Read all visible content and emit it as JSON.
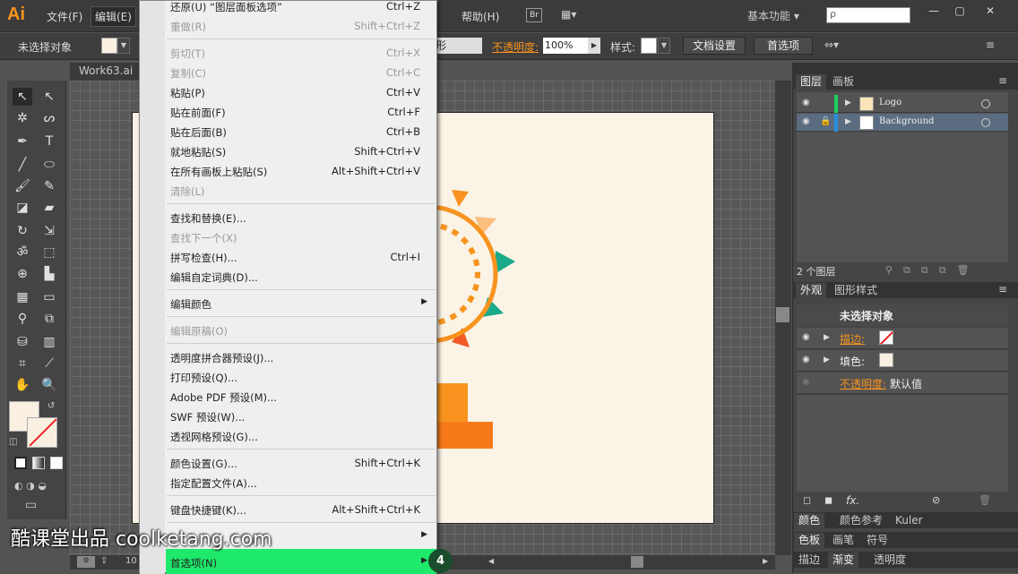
{
  "app": {
    "logo": "Ai",
    "document_tab": "Work63.ai"
  },
  "menubar": {
    "file": "文件(F)",
    "edit": "编辑(E)",
    "help": "帮助(H)",
    "bridge": "Br",
    "arrange": "▦▾",
    "workspace": "基本功能 ▾",
    "search_placeholder": "ρ"
  },
  "window_controls": {
    "minimize": "—",
    "maximize": "▢",
    "close": "✕"
  },
  "control_bar": {
    "selection": "未选择对象",
    "shape": "形",
    "opacity_label": "不透明度:",
    "opacity_value": "100%",
    "style_label": "样式:",
    "doc_settings": "文档设置",
    "preferences": "首选项"
  },
  "edit_menu": {
    "items": [
      {
        "label": "还原(U) “图层面板选项”",
        "shortcut": "Ctrl+Z",
        "disabled": false
      },
      {
        "label": "重做(R)",
        "shortcut": "Shift+Ctrl+Z",
        "disabled": true
      },
      {
        "label": "剪切(T)",
        "shortcut": "Ctrl+X",
        "disabled": true
      },
      {
        "label": "复制(C)",
        "shortcut": "Ctrl+C",
        "disabled": true
      },
      {
        "label": "粘贴(P)",
        "shortcut": "Ctrl+V",
        "disabled": false
      },
      {
        "label": "贴在前面(F)",
        "shortcut": "Ctrl+F",
        "disabled": false
      },
      {
        "label": "贴在后面(B)",
        "shortcut": "Ctrl+B",
        "disabled": false
      },
      {
        "label": "就地粘贴(S)",
        "shortcut": "Shift+Ctrl+V",
        "disabled": false
      },
      {
        "label": "在所有画板上粘贴(S)",
        "shortcut": "Alt+Shift+Ctrl+V",
        "disabled": false
      },
      {
        "label": "清除(L)",
        "shortcut": "",
        "disabled": true
      },
      {
        "label": "查找和替换(E)...",
        "shortcut": "",
        "disabled": false
      },
      {
        "label": "查找下一个(X)",
        "shortcut": "",
        "disabled": true
      },
      {
        "label": "拼写检查(H)...",
        "shortcut": "Ctrl+I",
        "disabled": false
      },
      {
        "label": "编辑自定词典(D)...",
        "shortcut": "",
        "disabled": false
      },
      {
        "label": "编辑颜色",
        "shortcut": "",
        "disabled": false
      },
      {
        "label": "编辑原稿(O)",
        "shortcut": "",
        "disabled": true
      },
      {
        "label": "透明度拼合器预设(J)...",
        "shortcut": "",
        "disabled": false
      },
      {
        "label": "打印预设(Q)...",
        "shortcut": "",
        "disabled": false
      },
      {
        "label": "Adobe PDF 预设(M)...",
        "shortcut": "",
        "disabled": false
      },
      {
        "label": "SWF 预设(W)...",
        "shortcut": "",
        "disabled": false
      },
      {
        "label": "透视网格预设(G)...",
        "shortcut": "",
        "disabled": false
      },
      {
        "label": "颜色设置(G)...",
        "shortcut": "Shift+Ctrl+K",
        "disabled": false
      },
      {
        "label": "指定配置文件(A)...",
        "shortcut": "",
        "disabled": false
      },
      {
        "label": "键盘快捷键(K)...",
        "shortcut": "Alt+Shift+Ctrl+K",
        "disabled": false
      },
      {
        "label": "",
        "shortcut": "",
        "disabled": false
      },
      {
        "label": "首选项(N)",
        "shortcut": "",
        "disabled": false
      }
    ],
    "step_badge": "4"
  },
  "layers_panel": {
    "tabs": [
      "图层",
      "画板"
    ],
    "layers": [
      {
        "name": "Logo"
      },
      {
        "name": "Background"
      }
    ],
    "count": "2 个图层"
  },
  "appearance_panel": {
    "tabs": [
      "外观",
      "图形样式"
    ],
    "title": "未选择对象",
    "stroke_label": "描边:",
    "fill_label": "填色:",
    "opacity_label": "不透明度:",
    "opacity_value": "默认值",
    "footer_fx": "fx."
  },
  "bottom_panels": {
    "row1": [
      "颜色",
      "颜色参考",
      "Kuler"
    ],
    "row2": [
      "色板",
      "画笔",
      "符号"
    ],
    "row3": [
      "描边",
      "渐变",
      "透明度"
    ]
  },
  "statusbar": {
    "zoom": "10"
  },
  "watermark": "酷课堂出品 coolketang.com",
  "colors": {
    "accent": "#f7931e",
    "highlight": "#1ee96a",
    "selected_layer": "#5b6c81",
    "sun_orange": "#f7931e",
    "sun_teal": "#1aaa8a",
    "artboard": "#faf3e6"
  }
}
